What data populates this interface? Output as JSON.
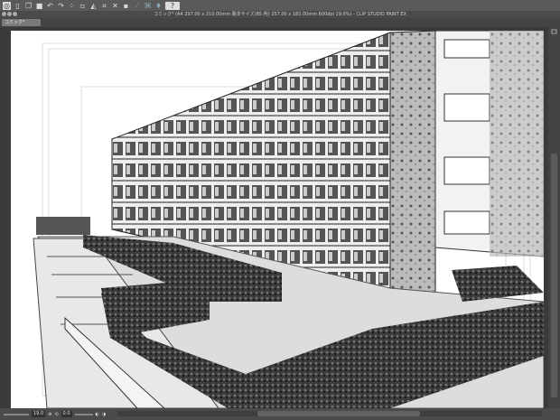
{
  "app": {
    "title": "コミック* (A4 297.00 x 210.00mm 製本サイズ(B5 判) 257.00 x 182.00mm 600dpi 19.0%) - CLIP STUDIO PAINT EX"
  },
  "tab": {
    "label": "コミック*"
  },
  "toolbar": {
    "icons": [
      "clip-studio-menu-icon",
      "new-icon",
      "open-icon",
      "save-icon",
      "undo-icon",
      "redo-icon",
      "select-all-icon",
      "deselect-icon",
      "fill-icon",
      "transform-icon",
      "clear-icon",
      "lasso-icon",
      "snap-ruler-icon",
      "snap-grid-icon",
      "snap-perspective-icon",
      "help-icon"
    ]
  },
  "status": {
    "zoom": "19.0",
    "rotation": "0.0"
  },
  "colors": {
    "bg": "#3c3c3c",
    "canvas": "#ffffff"
  }
}
